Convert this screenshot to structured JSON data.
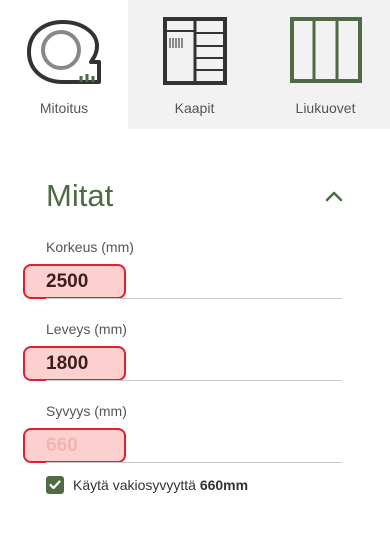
{
  "tabs": [
    {
      "label": "Mitoitus",
      "icon": "tape-measure-icon",
      "active": true
    },
    {
      "label": "Kaapit",
      "icon": "wardrobe-shelves-icon",
      "active": false
    },
    {
      "label": "Liukuovet",
      "icon": "sliding-doors-icon",
      "active": false
    }
  ],
  "section": {
    "title": "Mitat",
    "toggle_icon": "chevron-up-icon"
  },
  "fields": {
    "height": {
      "label": "Korkeus (mm)",
      "value": "2500"
    },
    "width": {
      "label": "Leveys (mm)",
      "value": "1800"
    },
    "depth": {
      "label": "Syvyys (mm)",
      "value": "660",
      "disabled": true
    }
  },
  "default_depth": {
    "checked": true,
    "label": "Käytä vakiosyvyyttä ",
    "value": "660mm"
  },
  "colors": {
    "accent": "#4e6b45",
    "error_border": "#e0202a",
    "error_fill": "#fdd0d0",
    "tab_inactive": "#f2f2f2"
  }
}
